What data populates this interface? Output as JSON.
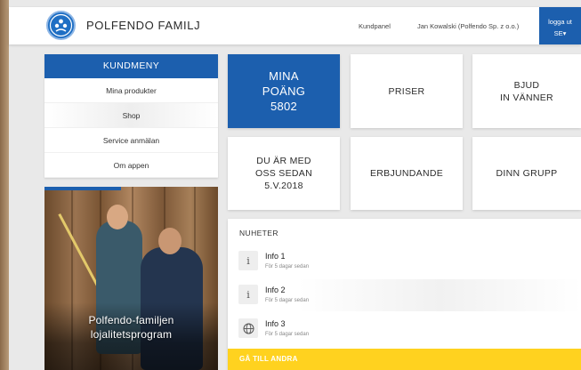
{
  "header": {
    "brand": "POLFENDO FAMILJ",
    "nav_kundpanel": "Kundpanel",
    "user": "Jan Kowalski (Polfendo Sp. z o.o.)",
    "logout": "logga ut",
    "language": "SE"
  },
  "menu": {
    "title": "KUNDMENY",
    "items": [
      {
        "label": "Mina produkter"
      },
      {
        "label": "Shop"
      },
      {
        "label": "Service anmälan"
      },
      {
        "label": "Om appen"
      }
    ]
  },
  "promo": {
    "text_line1": "Polfendo-familjen",
    "text_line2": "lojalitetsprogram"
  },
  "tiles": {
    "points_line1": "MINA",
    "points_line2": "POÄNG",
    "points_value": "5802",
    "prices": "PRISER",
    "invite_line1": "BJUD",
    "invite_line2": "IN VÄNNER",
    "member_line1": "DU ÄR MED",
    "member_line2": "OSS SEDAN",
    "member_date": "5.V.2018",
    "offers": "ERBJUNDANDE",
    "group": "DINN GRUPP"
  },
  "news": {
    "title": "NUHETER",
    "items": [
      {
        "icon": "info-icon",
        "title": "Info 1",
        "date": "För 5 dagar sedan"
      },
      {
        "icon": "info-icon",
        "title": "Info 2",
        "date": "För 5 dagar sedan"
      },
      {
        "icon": "globe-icon",
        "title": "Info 3",
        "date": "För 5 dagar sedan"
      }
    ],
    "footer": "GÅ TILL ANDRA"
  },
  "colors": {
    "primary_blue": "#1c5fae",
    "accent_yellow": "#ffd21f",
    "background": "#e9e9e9"
  }
}
